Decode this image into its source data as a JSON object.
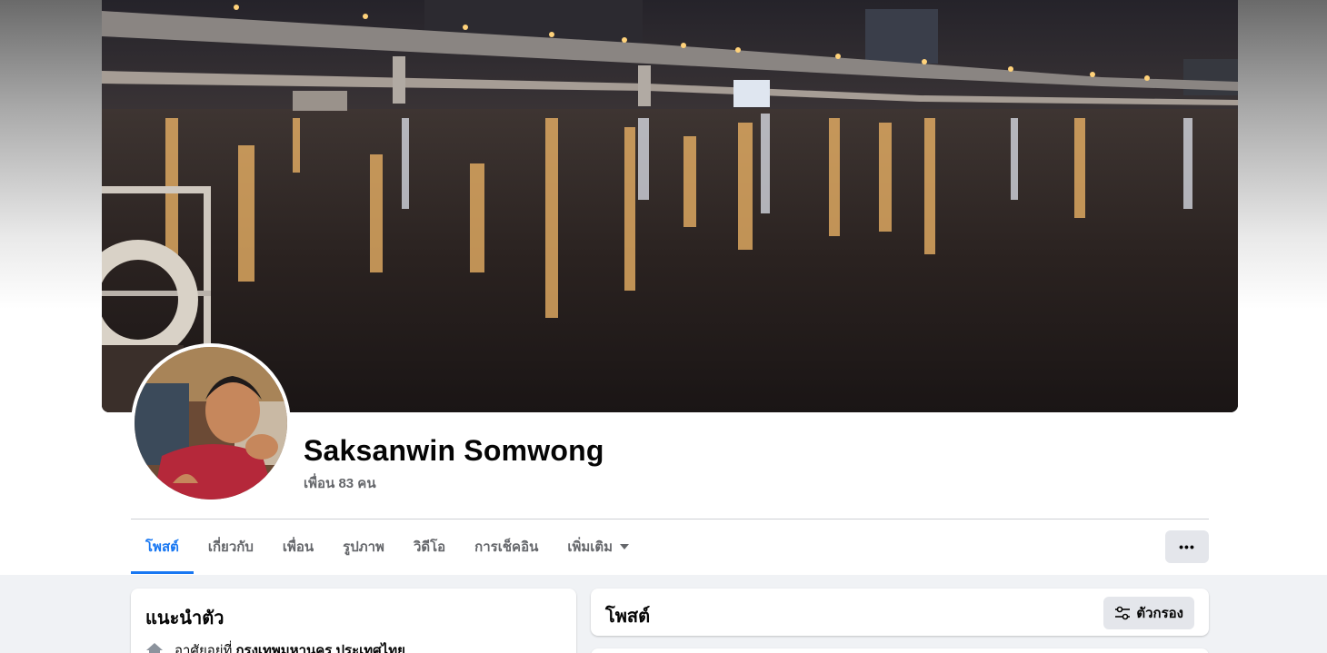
{
  "profile": {
    "name": "Saksanwin Somwong",
    "friends": "เพื่อน 83 คน"
  },
  "tabs": [
    {
      "label": "โพสต์",
      "active": true
    },
    {
      "label": "เกี่ยวกับ",
      "active": false
    },
    {
      "label": "เพื่อน",
      "active": false
    },
    {
      "label": "รูปภาพ",
      "active": false
    },
    {
      "label": "วิดีโอ",
      "active": false
    },
    {
      "label": "การเช็คอิน",
      "active": false
    },
    {
      "label": "เพิ่มเติม",
      "active": false
    }
  ],
  "more_button": "•••",
  "intro": {
    "title": "แนะนำตัว",
    "lives_in_prefix": "อาศัยอยู่ที่",
    "lives_in_place": "กรุงเทพมหานคร ประเทศไทย",
    "icon": "home-icon"
  },
  "posts": {
    "title": "โพสต์",
    "filter_label": "ตัวกรอง",
    "filter_icon": "filter-sliders-icon"
  },
  "colors": {
    "accent": "#1877f2",
    "secondary_text": "#65676b",
    "button_bg": "#e4e6eb",
    "page_bg": "#f0f2f5"
  }
}
